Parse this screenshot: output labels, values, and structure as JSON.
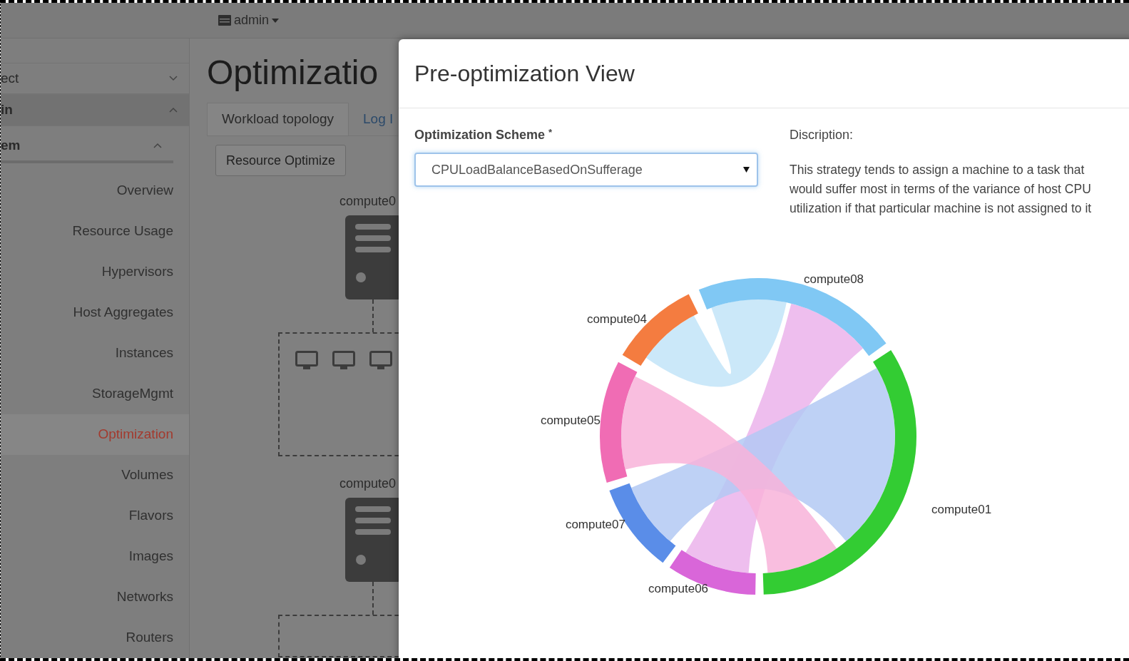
{
  "top_bar": {
    "user_menu": "admin"
  },
  "sidebar": {
    "sections": [
      {
        "label": "ect",
        "expanded": false
      },
      {
        "label": "in",
        "expanded": true
      },
      {
        "label": "em",
        "expanded": true
      }
    ],
    "items": [
      {
        "label": "Overview",
        "selected": false
      },
      {
        "label": "Resource Usage",
        "selected": false
      },
      {
        "label": "Hypervisors",
        "selected": false
      },
      {
        "label": "Host Aggregates",
        "selected": false
      },
      {
        "label": "Instances",
        "selected": false
      },
      {
        "label": "StorageMgmt",
        "selected": false
      },
      {
        "label": "Optimization",
        "selected": true
      },
      {
        "label": "Volumes",
        "selected": false
      },
      {
        "label": "Flavors",
        "selected": false
      },
      {
        "label": "Images",
        "selected": false
      },
      {
        "label": "Networks",
        "selected": false
      },
      {
        "label": "Routers",
        "selected": false
      }
    ]
  },
  "page": {
    "title": "Optimizatio",
    "tabs": [
      {
        "label": "Workload topology",
        "selected": true
      },
      {
        "label": "Log I",
        "selected": false
      }
    ],
    "action_button": "Resource Optimize",
    "topology_nodes": [
      {
        "label": "compute0"
      },
      {
        "label": "compute0"
      }
    ]
  },
  "modal": {
    "title": "Pre-optimization View",
    "scheme_field": {
      "label": "Optimization Scheme",
      "required_mark": "*",
      "value": "CPULoadBalanceBasedOnSufferage"
    },
    "description_label": "Discription:",
    "description": "This strategy tends to assign a machine to a task that would suffer most in terms of the variance of host CPU utilization if that particular machine is not assigned to it",
    "chord_diagram": {
      "groups": [
        {
          "label": "compute08",
          "color": "#80c8f4"
        },
        {
          "label": "compute04",
          "color": "#f47c40"
        },
        {
          "label": "compute05",
          "color": "#f06cb4"
        },
        {
          "label": "compute01",
          "color": "#33cc33"
        },
        {
          "label": "compute07",
          "color": "#5a8de8"
        },
        {
          "label": "compute06",
          "color": "#d966d9"
        }
      ]
    }
  }
}
